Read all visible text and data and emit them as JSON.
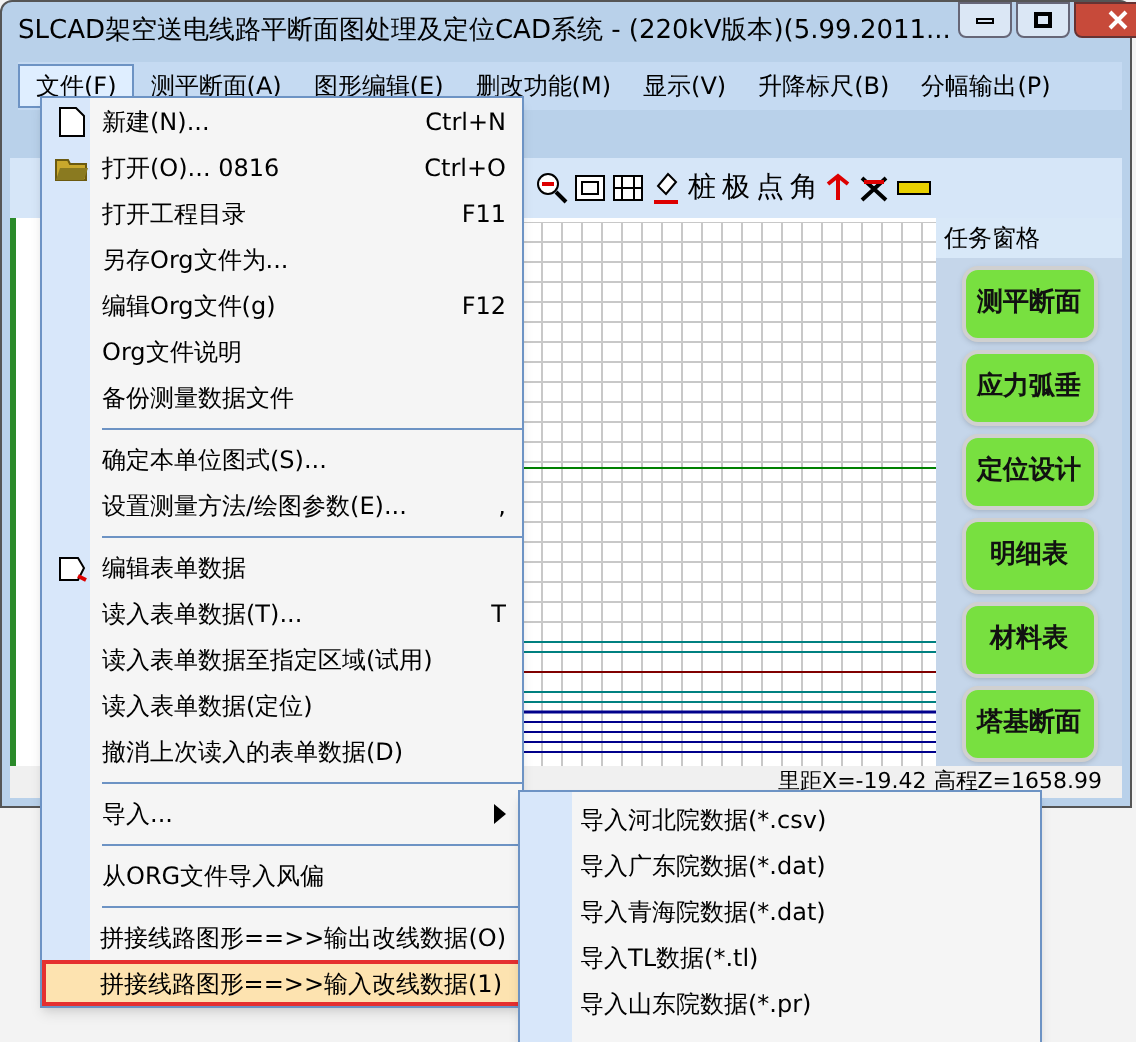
{
  "window": {
    "title": "SLCAD架空送电线路平断面图处理及定位CAD系统 - (220kV版本)(5.99.2011..."
  },
  "menu_bar": [
    {
      "label": "文件(F)",
      "selected": true
    },
    {
      "label": "测平断面(A)",
      "selected": false
    },
    {
      "label": "图形编辑(E)",
      "selected": false
    },
    {
      "label": "删改功能(M)",
      "selected": false
    },
    {
      "label": "显示(V)",
      "selected": false
    },
    {
      "label": "升降标尺(B)",
      "selected": false
    },
    {
      "label": "分幅输出(P)",
      "selected": false
    }
  ],
  "toolbar": {
    "char_buttons": [
      "桩",
      "极",
      "点",
      "角"
    ]
  },
  "task_pane": {
    "title": "任务窗格",
    "buttons": [
      "测平断面",
      "应力弧垂",
      "定位设计",
      "明细表",
      "材料表",
      "塔基断面"
    ]
  },
  "status_bar": {
    "reading": "里距X=-19.42 高程Z=1658.99"
  },
  "file_menu": [
    {
      "kind": "item",
      "label": "新建(N)...",
      "shortcut": "Ctrl+N",
      "selected": false
    },
    {
      "kind": "item",
      "label": "打开(O)...  0816",
      "shortcut": "Ctrl+O",
      "selected": false
    },
    {
      "kind": "item",
      "label": "打开工程目录",
      "shortcut": "F11",
      "selected": false
    },
    {
      "kind": "item",
      "label": "另存Org文件为...",
      "selected": false
    },
    {
      "kind": "item",
      "label": "编辑Org文件(g)",
      "shortcut": "F12",
      "selected": false
    },
    {
      "kind": "item",
      "label": "Org文件说明",
      "selected": false
    },
    {
      "kind": "item",
      "label": "备份测量数据文件",
      "selected": false
    },
    {
      "kind": "separator"
    },
    {
      "kind": "item",
      "label": "确定本单位图式(S)...",
      "selected": false
    },
    {
      "kind": "item",
      "label": "设置测量方法/绘图参数(E)...",
      "shortcut": ",",
      "selected": false
    },
    {
      "kind": "separator"
    },
    {
      "kind": "item",
      "label": "编辑表单数据",
      "selected": false
    },
    {
      "kind": "item",
      "label": "读入表单数据(T)...",
      "shortcut": "T",
      "selected": false
    },
    {
      "kind": "item",
      "label": "读入表单数据至指定区域(试用)",
      "selected": false
    },
    {
      "kind": "item",
      "label": "读入表单数据(定位)",
      "selected": false
    },
    {
      "kind": "item",
      "label": "撤消上次读入的表单数据(D)",
      "selected": false
    },
    {
      "kind": "separator"
    },
    {
      "kind": "submenu",
      "label": "导入...",
      "selected": false
    },
    {
      "kind": "separator"
    },
    {
      "kind": "item",
      "label": "从ORG文件导入风偏",
      "selected": false
    },
    {
      "kind": "separator"
    },
    {
      "kind": "item",
      "label": "拼接线路图形==>>输出改线数据(O)",
      "selected": false
    },
    {
      "kind": "item",
      "label": "拼接线路图形==>>输入改线数据(1)",
      "selected": true
    }
  ],
  "import_submenu": [
    "导入河北院数据(*.csv)",
    "导入广东院数据(*.dat)",
    "导入青海院数据(*.dat)",
    "导入TL数据(*.tl)",
    "导入山东院数据(*.pr)"
  ]
}
